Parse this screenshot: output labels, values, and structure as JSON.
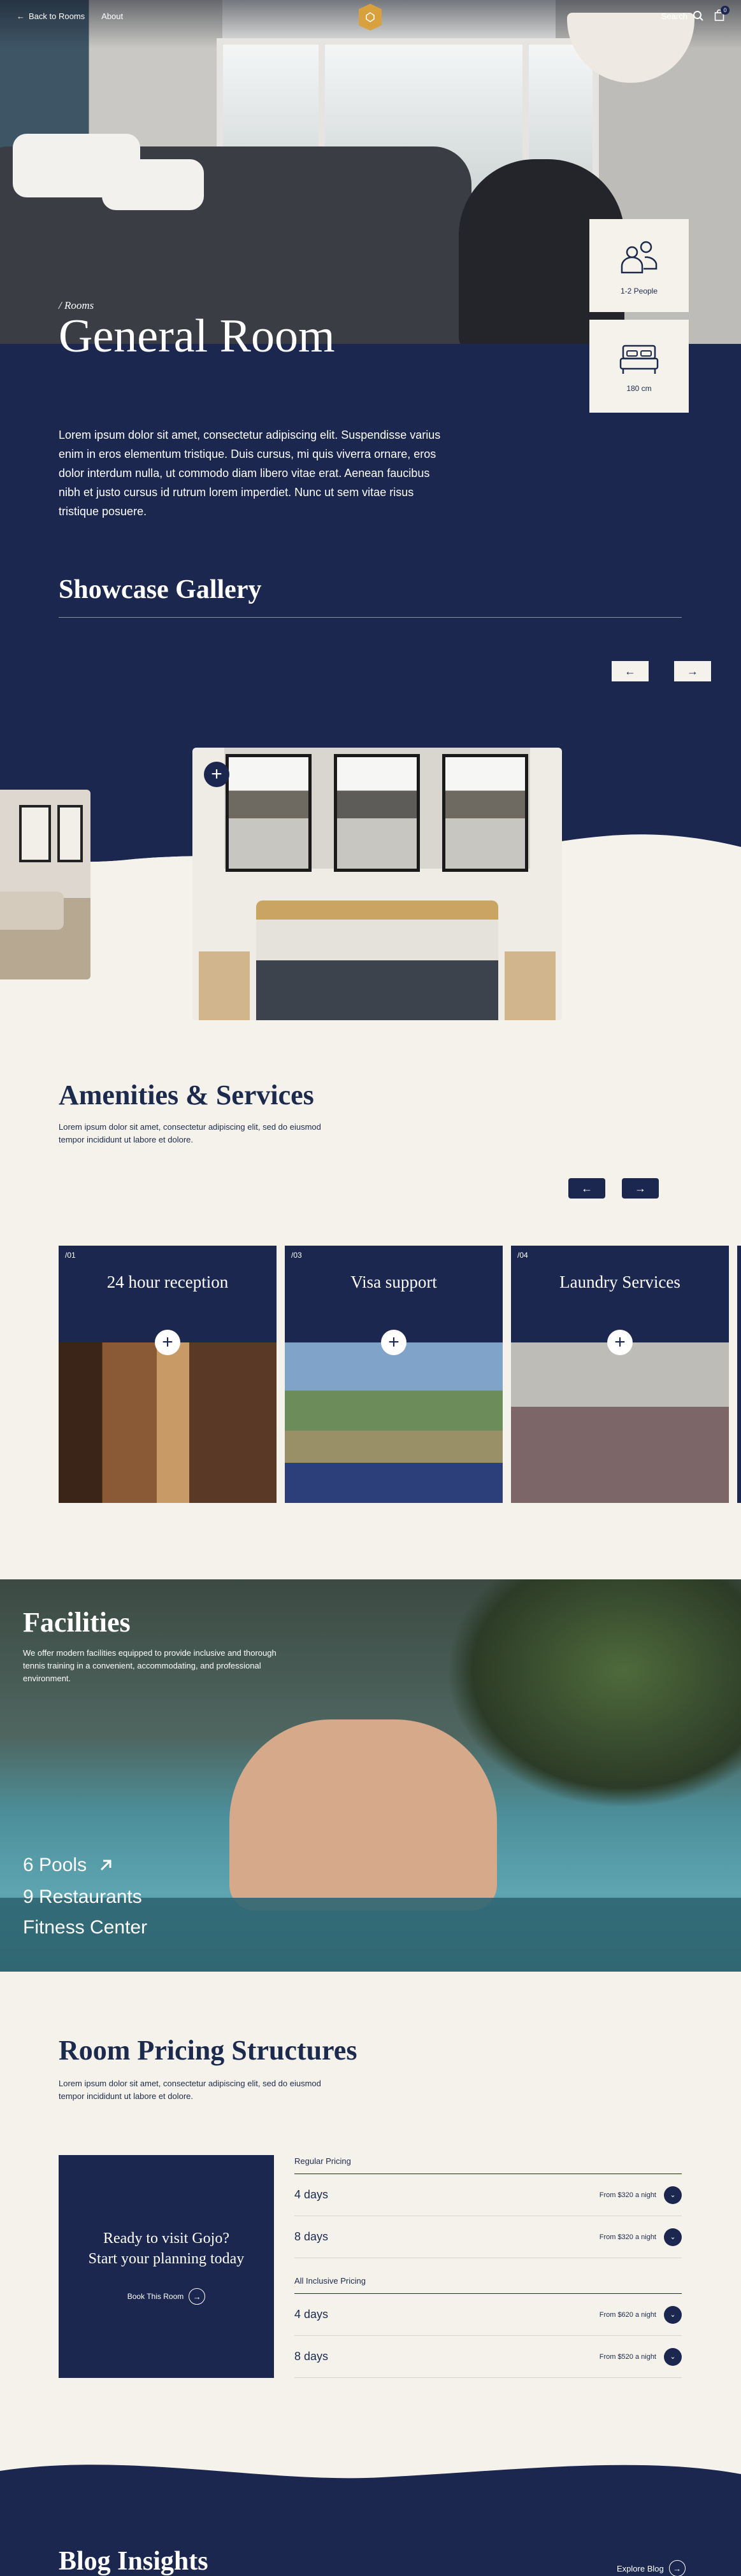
{
  "nav": {
    "back_label": "Back to Rooms",
    "about_label": "About",
    "search_label": "Search",
    "cart_count": "0"
  },
  "room": {
    "breadcrumb": "/ Rooms",
    "title": "General Room",
    "description": "Lorem ipsum dolor sit amet, consectetur adipiscing elit. Suspendisse varius enim in eros elementum tristique. Duis cursus, mi quis viverra ornare, eros dolor interdum nulla, ut commodo diam libero vitae erat. Aenean faucibus nibh et justo cursus id rutrum lorem imperdiet. Nunc ut sem vitae risus tristique posuere.",
    "capacity": "1-2 People",
    "bed_size": "180 cm"
  },
  "gallery": {
    "title": "Showcase Gallery"
  },
  "amenities": {
    "title": "Amenities & Services",
    "description": "Lorem ipsum dolor sit amet, consectetur adipiscing elit, sed do eiusmod tempor incididunt ut labore et dolore.",
    "items": [
      {
        "num": "/01",
        "name": "24 hour reception"
      },
      {
        "num": "/03",
        "name": "Visa support"
      },
      {
        "num": "/04",
        "name": "Laundry Services"
      }
    ]
  },
  "facilities": {
    "title": "Facilities",
    "description": "We offer modern facilities equipped to provide inclusive and thorough tennis training in a convenient, accommodating, and professional environment.",
    "items": [
      "6 Pools",
      "9 Restaurants",
      "Fitness Center"
    ]
  },
  "pricing": {
    "title": "Room Pricing Structures",
    "description": "Lorem ipsum dolor sit amet, consectetur adipiscing elit, sed do eiusmod tempor incididunt ut labore et dolore.",
    "cta_heading_1": "Ready to visit Gojo?",
    "cta_heading_2": "Start your planning today",
    "cta_button": "Book This Room",
    "regular_label": "Regular Pricing",
    "regular": [
      {
        "days": "4 days",
        "price": "From $320 a night"
      },
      {
        "days": "8 days",
        "price": "From $320 a night"
      }
    ],
    "inclusive_label": "All Inclusive Pricing",
    "inclusive": [
      {
        "days": "4 days",
        "price": "From $620 a night"
      },
      {
        "days": "8 days",
        "price": "From $520 a night"
      }
    ]
  },
  "blog": {
    "title": "Blog Insights",
    "link": "Explore Blog"
  },
  "colors": {
    "navy": "#1b274e",
    "cream": "#f4f2ea",
    "gold": "#d8a13e"
  }
}
